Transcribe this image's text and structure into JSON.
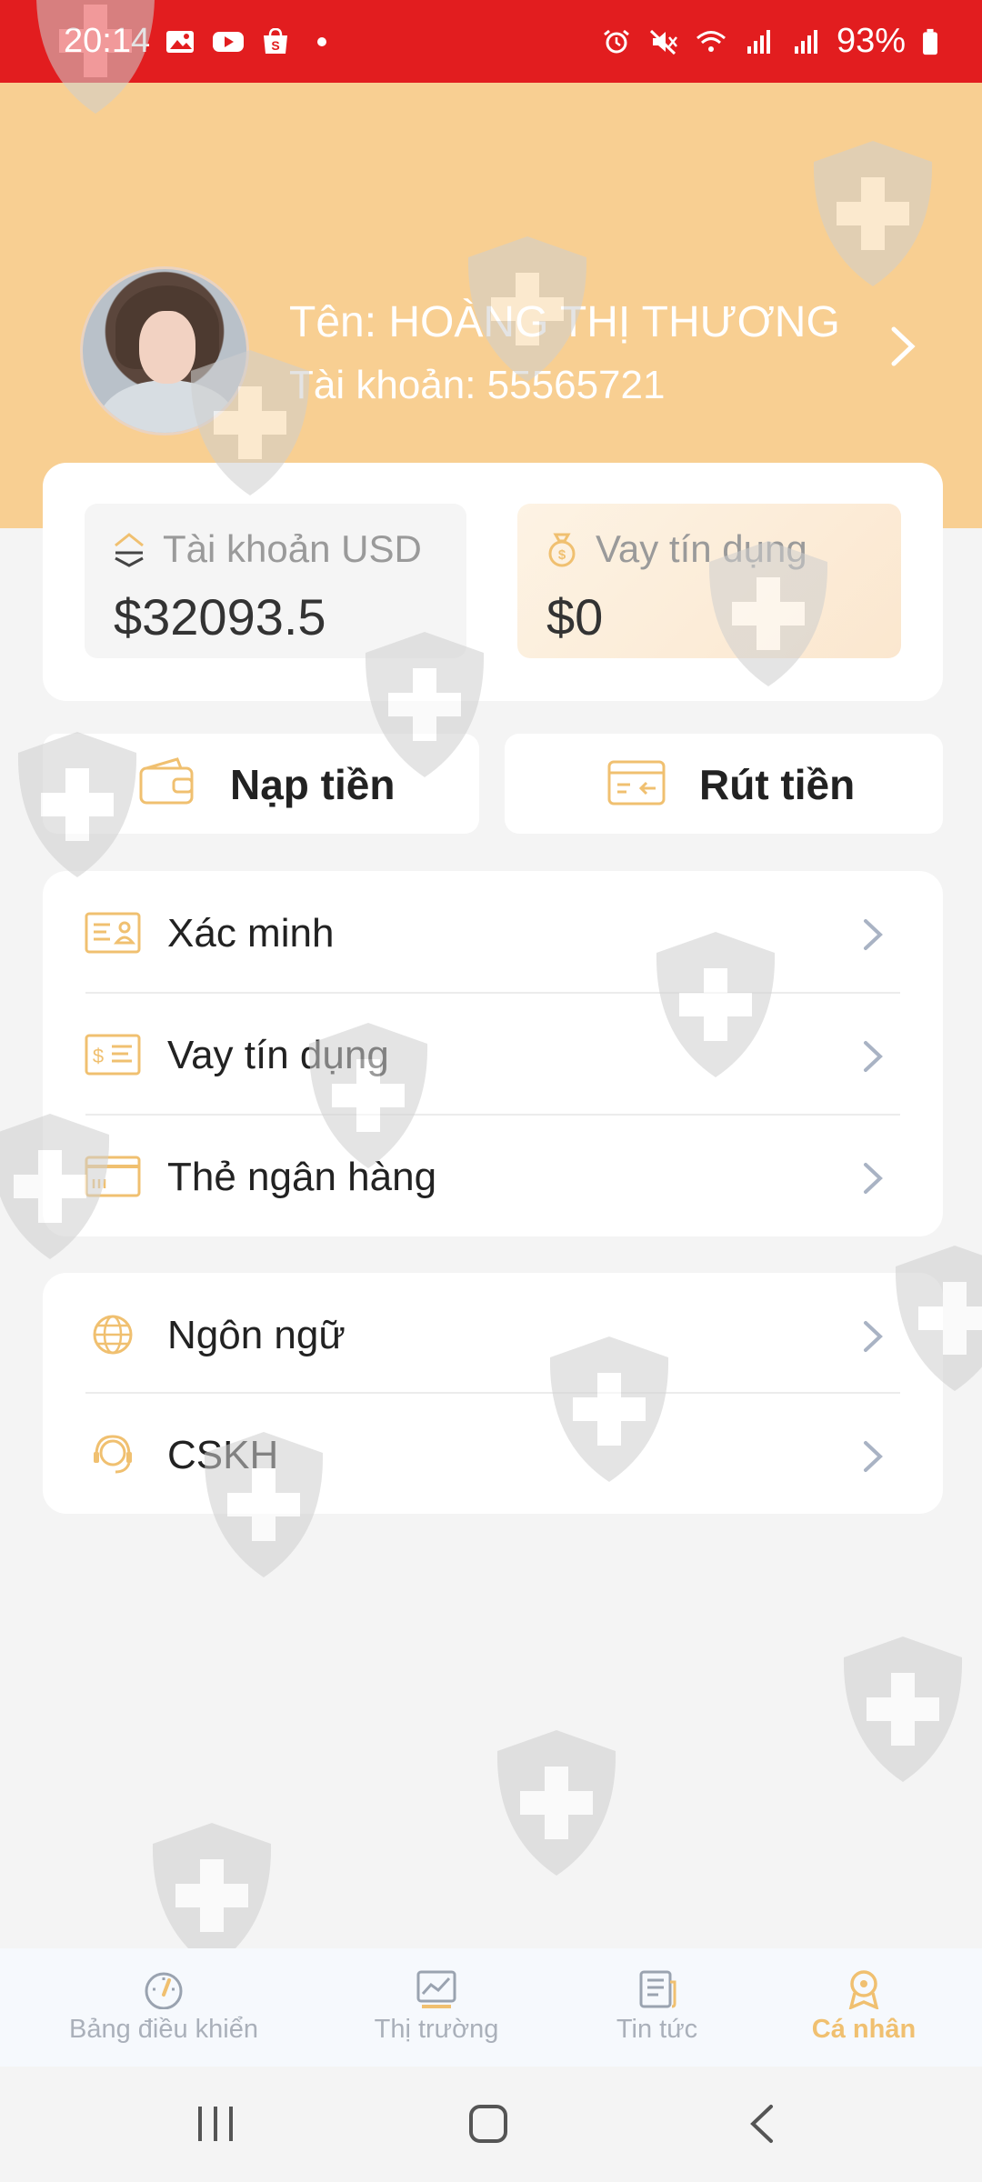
{
  "status_bar": {
    "time": "20:14",
    "battery": "93%",
    "left_icons": [
      "gallery-icon",
      "youtube-icon",
      "shopee-icon"
    ],
    "right_icons": [
      "alarm-icon",
      "mute-icon",
      "wifi-icon",
      "signal-icon",
      "signal-icon",
      "battery-icon"
    ]
  },
  "profile": {
    "name_text": "Tên:  HOÀNG THỊ THƯƠNG",
    "account_text": "Tài khoản:  55565721"
  },
  "wallet": {
    "usd_label": "Tài khoản USD",
    "usd_value": "$32093.5",
    "loan_label": "Vay tín dụng",
    "loan_value": "$0"
  },
  "actions": {
    "deposit": "Nạp tiền",
    "withdraw": "Rút tiền"
  },
  "menu_main": [
    {
      "label": "Xác minh",
      "icon": "id-card-icon"
    },
    {
      "label": "Vay tín dụng",
      "icon": "loan-document-icon"
    },
    {
      "label": "Thẻ ngân hàng",
      "icon": "bank-card-icon"
    }
  ],
  "menu_settings": [
    {
      "label": "Ngôn ngữ",
      "icon": "globe-icon"
    },
    {
      "label": "CSKH",
      "icon": "headset-icon"
    }
  ],
  "bottom_nav": [
    {
      "label": "Bảng điều khiển",
      "icon": "dashboard-gauge-icon"
    },
    {
      "label": "Thị trường",
      "icon": "market-chart-icon"
    },
    {
      "label": "Tin tức",
      "icon": "news-icon"
    },
    {
      "label": "Cá nhân",
      "icon": "profile-badge-icon",
      "active": true
    }
  ],
  "colors": {
    "status_bar": "#e21d1f",
    "header": "#f8cf92",
    "accent": "#f0c070",
    "background": "#f4f4f4"
  }
}
